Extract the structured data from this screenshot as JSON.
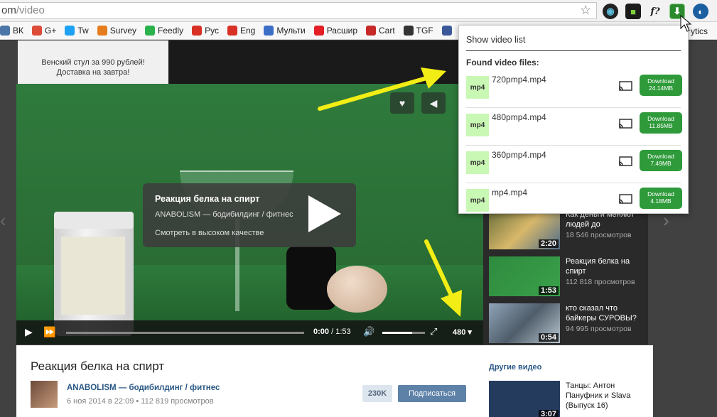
{
  "browser": {
    "url_host_tail": "om",
    "url_path": "/video",
    "extensions": [
      "camera-icon",
      "green-square-icon",
      "fquestion-icon",
      "download-arrow-icon",
      "browser-logo-icon"
    ],
    "fq_label": "f?"
  },
  "bookmarks": [
    {
      "label": "ВК",
      "color": "#4a76a8"
    },
    {
      "label": "G+",
      "color": "#dd4b39"
    },
    {
      "label": "Tw",
      "color": "#1da1f2"
    },
    {
      "label": "Survey",
      "color": "#e57c1e"
    },
    {
      "label": "Feedly",
      "color": "#2bb24c"
    },
    {
      "label": "Рус",
      "color": "#d93025"
    },
    {
      "label": "Eng",
      "color": "#d93025"
    },
    {
      "label": "Мульти",
      "color": "#3b6ec7"
    },
    {
      "label": "Расшир",
      "color": "#e31e24"
    },
    {
      "label": "Cart",
      "color": "#c62828"
    },
    {
      "label": "TGF",
      "color": "#333333"
    }
  ],
  "bookmark_tail": "ytics",
  "ad": {
    "text": "Венский стул за 990 рублей! Доставка на завтра!"
  },
  "player": {
    "title": "Реакция белка на спирт",
    "channel": "ANABOLISM — бодибилдинг / фитнес",
    "hq": "Смотреть в высоком качестве",
    "time_current": "0:00",
    "time_sep": " / ",
    "time_total": "1:53",
    "quality": "480"
  },
  "sidebar_videos": [
    {
      "title": "Как деньги меняют людей до",
      "views": "18 546 просмотров",
      "duration": "2:20"
    },
    {
      "title": "Реакция белка на спирт",
      "views": "112 818 просмотров",
      "duration": "1:53"
    },
    {
      "title": "кто сказал что байкеры СУРОВЫ?",
      "views": "94 995 просмотров",
      "duration": "0:54"
    }
  ],
  "details": {
    "title": "Реакция белка на спирт",
    "channel": "ANABOLISM — бодибилдинг / фитнес",
    "meta": "6 ноя 2014 в 22:09  •  112 819 просмотров",
    "subs_count": "230K",
    "subscribe_label": "Подписаться",
    "other_videos": "Другие видео",
    "other_title": "Танцы: Антон Пануфник и Slava (Выпуск 16)",
    "other_duration": "3:07"
  },
  "popup": {
    "show_list": "Show video list",
    "found": "Found video files:",
    "files": [
      {
        "badge": "mp4",
        "name": "720pmp4.mp4",
        "btn": "Download",
        "size": "24.14MB"
      },
      {
        "badge": "mp4",
        "name": "480pmp4.mp4",
        "btn": "Download",
        "size": "11.85MB"
      },
      {
        "badge": "mp4",
        "name": "360pmp4.mp4",
        "btn": "Download",
        "size": "7.49MB"
      },
      {
        "badge": "mp4",
        "name": "mp4.mp4",
        "btn": "Download",
        "size": "4.18MB"
      }
    ]
  },
  "colors": {
    "accent_green": "#2e9a3a",
    "badge_green": "#c9f7b4",
    "arrow_yellow": "#f2ee15",
    "link_blue": "#2a5885"
  }
}
